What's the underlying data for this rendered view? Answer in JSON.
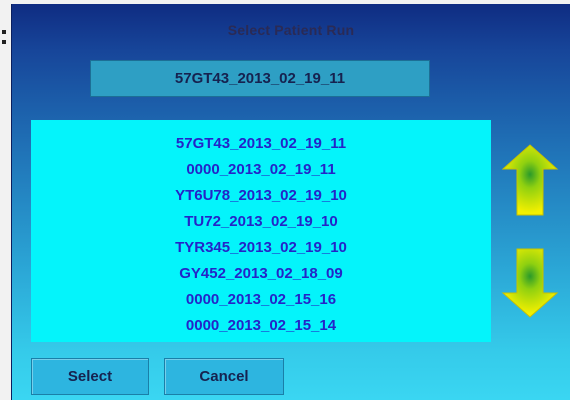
{
  "dialog": {
    "title": "Select Patient Run",
    "selected_run": "57GT43_2013_02_19_11"
  },
  "runs": [
    "57GT43_2013_02_19_11",
    "0000_2013_02_19_11",
    "YT6U78_2013_02_19_10",
    "TU72_2013_02_19_10",
    "TYR345_2013_02_19_10",
    "GY452_2013_02_18_09",
    "0000_2013_02_15_16",
    "0000_2013_02_15_14"
  ],
  "buttons": {
    "select_label": "Select",
    "cancel_label": "Cancel"
  },
  "icons": {
    "scroll_up": "arrow-up-icon",
    "scroll_down": "arrow-down-icon"
  },
  "colors": {
    "list_background": "#04f4fb",
    "list_text": "#2424c8",
    "arrow_fill": "#f4f000",
    "arrow_center": "#2a9a2a"
  }
}
